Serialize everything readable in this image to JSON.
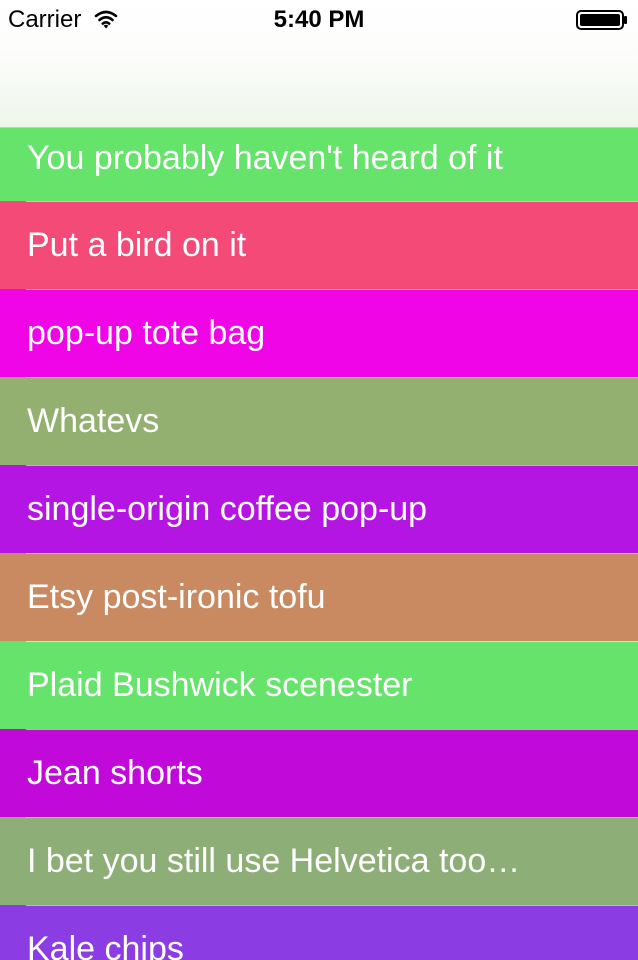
{
  "status_bar": {
    "carrier": "Carrier",
    "time": "5:40 PM",
    "wifi_icon": "wifi-icon",
    "battery_icon": "battery-icon"
  },
  "nav_bar": {
    "title": ""
  },
  "list": {
    "items": [
      {
        "label": "You probably haven't heard of it",
        "color": "#66e36b"
      },
      {
        "label": "Put a bird on it",
        "color": "#f34a78"
      },
      {
        "label": "pop-up tote bag",
        "color": "#ef05e6"
      },
      {
        "label": "Whatevs",
        "color": "#93b070"
      },
      {
        "label": "single-origin coffee pop-up",
        "color": "#b515e2"
      },
      {
        "label": "Etsy post-ironic tofu",
        "color": "#c98961"
      },
      {
        "label": "Plaid Bushwick scenester",
        "color": "#66e36b"
      },
      {
        "label": "Jean shorts",
        "color": "#c10ad9"
      },
      {
        "label": "I bet you still use Helvetica too…",
        "color": "#8daf77"
      },
      {
        "label": "Kale chips",
        "color": "#8b3ce2"
      }
    ]
  }
}
